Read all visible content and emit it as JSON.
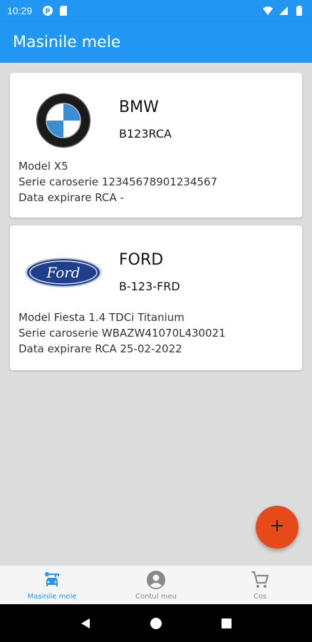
{
  "status": {
    "time": "10:29"
  },
  "app": {
    "title": "Masinile mele"
  },
  "cars": [
    {
      "brand": "BMW",
      "plate": "B123RCA",
      "model": "Model X5",
      "vin": "Serie caroserie 12345678901234567",
      "rca": "Data expirare RCA -",
      "logo": "bmw-logo"
    },
    {
      "brand": "FORD",
      "plate": "B-123-FRD",
      "model": "Model Fiesta 1.4 TDCi Titanium",
      "vin": "Serie caroserie WBAZW41070L430021",
      "rca": "Data expirare RCA 25-02-2022",
      "logo": "ford-logo",
      "logo_text": "Ford"
    }
  ],
  "fab": {
    "icon": "plus-icon"
  },
  "bottom_nav": [
    {
      "label": "Masinile mele",
      "icon": "car-icon",
      "active": true
    },
    {
      "label": "Contul meu",
      "icon": "account-icon",
      "active": false
    },
    {
      "label": "Cos",
      "icon": "cart-icon",
      "active": false
    }
  ],
  "colors": {
    "primary": "#2196f3",
    "accent": "#e64a19",
    "background": "#dcdcdc"
  }
}
